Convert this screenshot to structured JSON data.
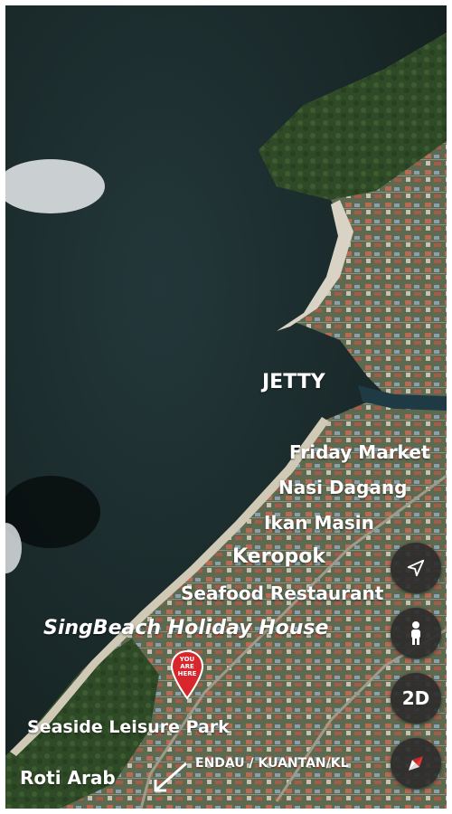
{
  "labels": {
    "jetty": "JETTY",
    "friday_market": "Friday Market",
    "nasi_dagang": "Nasi Dagang",
    "ikan_masin": "Ikan Masin",
    "keropok": "Keropok",
    "seafood_restaurant": "Seafood Restaurant",
    "singbeach": "SingBeach Holiday House",
    "seaside_park": "Seaside Leisure Park",
    "roti_arab": "Roti Arab",
    "endau": "ENDAU  / KUANTAN/KL"
  },
  "marker": {
    "line1": "YOU",
    "line2": "ARE",
    "line3": "HERE",
    "color": "#d9262c"
  },
  "controls": {
    "navigate_icon": "navigation-arrow-icon",
    "street_view_icon": "person-icon",
    "view_mode_label": "2D",
    "compass_icon": "compass-icon"
  },
  "colors": {
    "sea": "#1a2a2a",
    "land": "#3c5a33",
    "beach": "#d8d3c4",
    "control_bg": "#2d2d2d",
    "label_text": "#ffffff"
  }
}
